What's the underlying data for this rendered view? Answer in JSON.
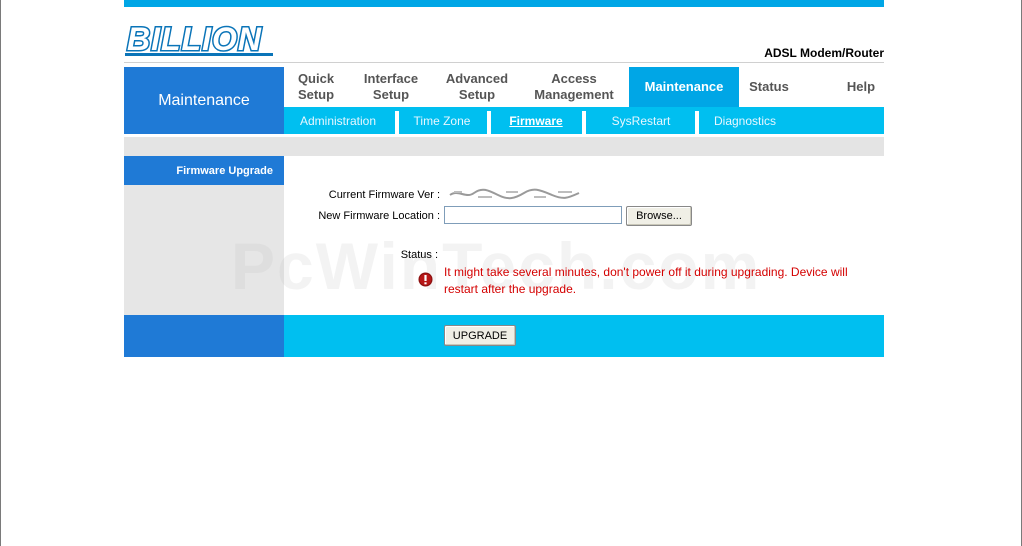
{
  "header": {
    "logo_text": "BILLION",
    "product": "ADSL Modem/Router"
  },
  "left_title": "Maintenance",
  "tabs": [
    {
      "line1": "Quick",
      "line2": "Setup"
    },
    {
      "line1": "Interface",
      "line2": "Setup"
    },
    {
      "line1": "Advanced",
      "line2": "Setup"
    },
    {
      "line1": "Access",
      "line2": "Management"
    },
    {
      "line1": "Maintenance",
      "line2": ""
    },
    {
      "line1": "Status",
      "line2": ""
    },
    {
      "line1": "Help",
      "line2": ""
    }
  ],
  "subtabs": [
    "Administration",
    "Time Zone",
    "Firmware",
    "SysRestart",
    "Diagnostics"
  ],
  "sidebar": {
    "heading": "Firmware Upgrade"
  },
  "form": {
    "current_fw_label": "Current Firmware Ver :",
    "new_fw_label": "New Firmware Location :",
    "file_value": "",
    "browse_label": "Browse...",
    "status_label": "Status :",
    "status_message": "It might take several minutes, don't power off it during upgrading. Device will restart after the upgrade.",
    "upgrade_label": "UPGRADE"
  },
  "watermark": "PcWinTech.com",
  "colors": {
    "accent_blue": "#1f7ad6",
    "cyan": "#00bff0",
    "tab_active": "#00a6e6",
    "warning_red": "#d40000"
  }
}
